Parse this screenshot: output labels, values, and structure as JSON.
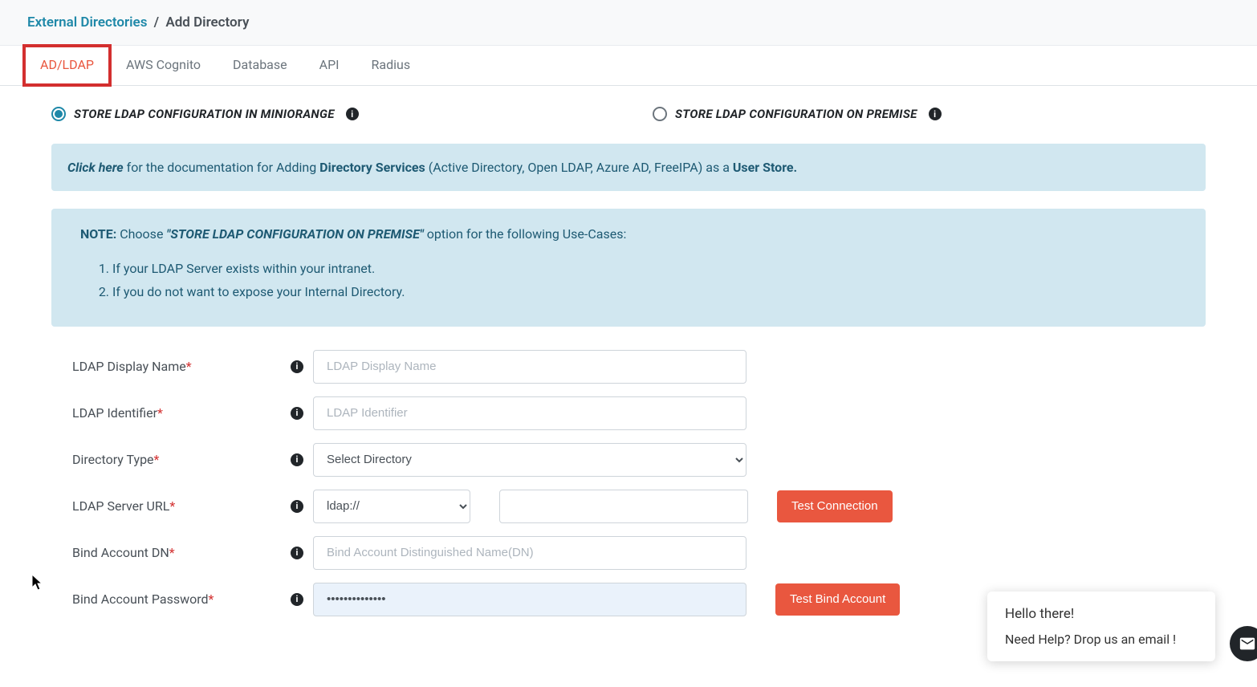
{
  "breadcrumb": {
    "parent": "External Directories",
    "sep": "/",
    "current": "Add Directory"
  },
  "tabs": {
    "adldap": "AD/LDAP",
    "cognito": "AWS Cognito",
    "database": "Database",
    "api": "API",
    "radius": "Radius"
  },
  "storage": {
    "miniorange": "STORE LDAP CONFIGURATION IN MINIORANGE",
    "onpremise": "STORE LDAP CONFIGURATION ON PREMISE"
  },
  "doc_box": {
    "click": "Click here",
    "mid1": " for the documentation for Adding ",
    "dirserv": "Directory Services",
    "mid2": " (Active Directory, Open LDAP, Azure AD, FreeIPA) as a ",
    "userstore": "User Store.",
    "end": ""
  },
  "note_box": {
    "note": "NOTE:",
    "choose": "  Choose ",
    "quote": "\"STORE LDAP CONFIGURATION ON PREMISE\"",
    "tail": " option for the following Use-Cases:",
    "item1": "If your LDAP Server exists within your intranet.",
    "item2": "If you do not want to expose your Internal Directory."
  },
  "form": {
    "display_name": {
      "label": "LDAP Display Name",
      "placeholder": "LDAP Display Name"
    },
    "identifier": {
      "label": "LDAP Identifier",
      "placeholder": "LDAP Identifier"
    },
    "dir_type": {
      "label": "Directory Type",
      "selected": "Select Directory"
    },
    "server_url": {
      "label": "LDAP Server URL",
      "protocol": "ldap://",
      "host": ""
    },
    "bind_dn": {
      "label": "Bind Account DN",
      "placeholder": "Bind Account Distinguished Name(DN)"
    },
    "bind_pw": {
      "label": "Bind Account Password",
      "value": "••••••••••••••"
    }
  },
  "buttons": {
    "test_conn": "Test Connection",
    "test_bind": "Test Bind Account"
  },
  "chat": {
    "greet": "Hello there!",
    "help": "Need Help? Drop us an email !"
  },
  "info_glyph": "i"
}
